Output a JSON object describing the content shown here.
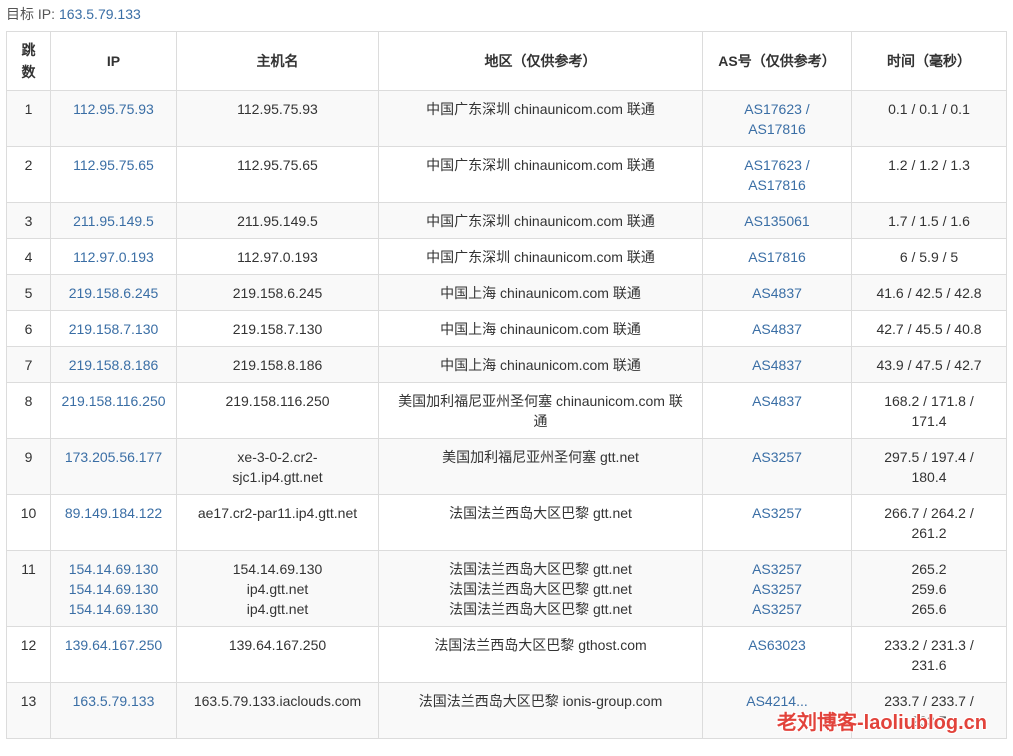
{
  "target": {
    "label": "目标 IP:",
    "ip": "163.5.79.133"
  },
  "headers": {
    "hop": "跳数",
    "ip": "IP",
    "host": "主机名",
    "region": "地区（仅供参考）",
    "as": "AS号（仅供参考）",
    "time": "时间（毫秒）"
  },
  "rows": [
    {
      "hop": "1",
      "ips": [
        "112.95.75.93"
      ],
      "hosts": [
        "112.95.75.93"
      ],
      "regions": [
        "中国广东深圳 chinaunicom.com 联通"
      ],
      "as": [
        "AS17623 /",
        "AS17816"
      ],
      "times": [
        "0.1 / 0.1 / 0.1"
      ]
    },
    {
      "hop": "2",
      "ips": [
        "112.95.75.65"
      ],
      "hosts": [
        "112.95.75.65"
      ],
      "regions": [
        "中国广东深圳 chinaunicom.com 联通"
      ],
      "as": [
        "AS17623 /",
        "AS17816"
      ],
      "times": [
        "1.2 / 1.2 / 1.3"
      ]
    },
    {
      "hop": "3",
      "ips": [
        "211.95.149.5"
      ],
      "hosts": [
        "211.95.149.5"
      ],
      "regions": [
        "中国广东深圳 chinaunicom.com 联通"
      ],
      "as": [
        "AS135061"
      ],
      "times": [
        "1.7 / 1.5 / 1.6"
      ]
    },
    {
      "hop": "4",
      "ips": [
        "112.97.0.193"
      ],
      "hosts": [
        "112.97.0.193"
      ],
      "regions": [
        "中国广东深圳 chinaunicom.com 联通"
      ],
      "as": [
        "AS17816"
      ],
      "times": [
        "6 / 5.9 / 5"
      ]
    },
    {
      "hop": "5",
      "ips": [
        "219.158.6.245"
      ],
      "hosts": [
        "219.158.6.245"
      ],
      "regions": [
        "中国上海 chinaunicom.com 联通"
      ],
      "as": [
        "AS4837"
      ],
      "times": [
        "41.6 / 42.5 / 42.8"
      ]
    },
    {
      "hop": "6",
      "ips": [
        "219.158.7.130"
      ],
      "hosts": [
        "219.158.7.130"
      ],
      "regions": [
        "中国上海 chinaunicom.com 联通"
      ],
      "as": [
        "AS4837"
      ],
      "times": [
        "42.7 / 45.5 / 40.8"
      ]
    },
    {
      "hop": "7",
      "ips": [
        "219.158.8.186"
      ],
      "hosts": [
        "219.158.8.186"
      ],
      "regions": [
        "中国上海 chinaunicom.com 联通"
      ],
      "as": [
        "AS4837"
      ],
      "times": [
        "43.9 / 47.5 / 42.7"
      ]
    },
    {
      "hop": "8",
      "ips": [
        "219.158.116.250"
      ],
      "hosts": [
        "219.158.116.250"
      ],
      "regions": [
        "美国加利福尼亚州圣何塞 chinaunicom.com 联",
        "通"
      ],
      "as": [
        "AS4837"
      ],
      "times": [
        "168.2 / 171.8 /",
        "171.4"
      ]
    },
    {
      "hop": "9",
      "ips": [
        "173.205.56.177"
      ],
      "hosts": [
        "xe-3-0-2.cr2-",
        "sjc1.ip4.gtt.net"
      ],
      "regions": [
        "美国加利福尼亚州圣何塞 gtt.net"
      ],
      "as": [
        "AS3257"
      ],
      "times": [
        "297.5 / 197.4 /",
        "180.4"
      ]
    },
    {
      "hop": "10",
      "ips": [
        "89.149.184.122"
      ],
      "hosts": [
        "ae17.cr2-par11.ip4.gtt.net"
      ],
      "regions": [
        "法国法兰西岛大区巴黎 gtt.net"
      ],
      "as": [
        "AS3257"
      ],
      "times": [
        "266.7 / 264.2 /",
        "261.2"
      ]
    },
    {
      "hop": "11",
      "ips": [
        "154.14.69.130",
        "154.14.69.130",
        "154.14.69.130"
      ],
      "hosts": [
        "154.14.69.130",
        "ip4.gtt.net",
        "ip4.gtt.net"
      ],
      "regions": [
        "法国法兰西岛大区巴黎 gtt.net",
        "法国法兰西岛大区巴黎 gtt.net",
        "法国法兰西岛大区巴黎 gtt.net"
      ],
      "as": [
        "AS3257",
        "AS3257",
        "AS3257"
      ],
      "times": [
        "265.2",
        "259.6",
        "265.6"
      ]
    },
    {
      "hop": "12",
      "ips": [
        "139.64.167.250"
      ],
      "hosts": [
        "139.64.167.250"
      ],
      "regions": [
        "法国法兰西岛大区巴黎 gthost.com"
      ],
      "as": [
        "AS63023"
      ],
      "times": [
        "233.2 / 231.3 /",
        "231.6"
      ]
    },
    {
      "hop": "13",
      "ips": [
        "163.5.79.133"
      ],
      "hosts": [
        "163.5.79.133.iaclouds.com"
      ],
      "regions": [
        "法国法兰西岛大区巴黎 ionis-group.com"
      ],
      "as": [
        "AS4214..."
      ],
      "times": [
        "233.7 / 233.7 /",
        "233.7"
      ]
    }
  ],
  "watermark": "老刘博客-laoliublog.cn"
}
